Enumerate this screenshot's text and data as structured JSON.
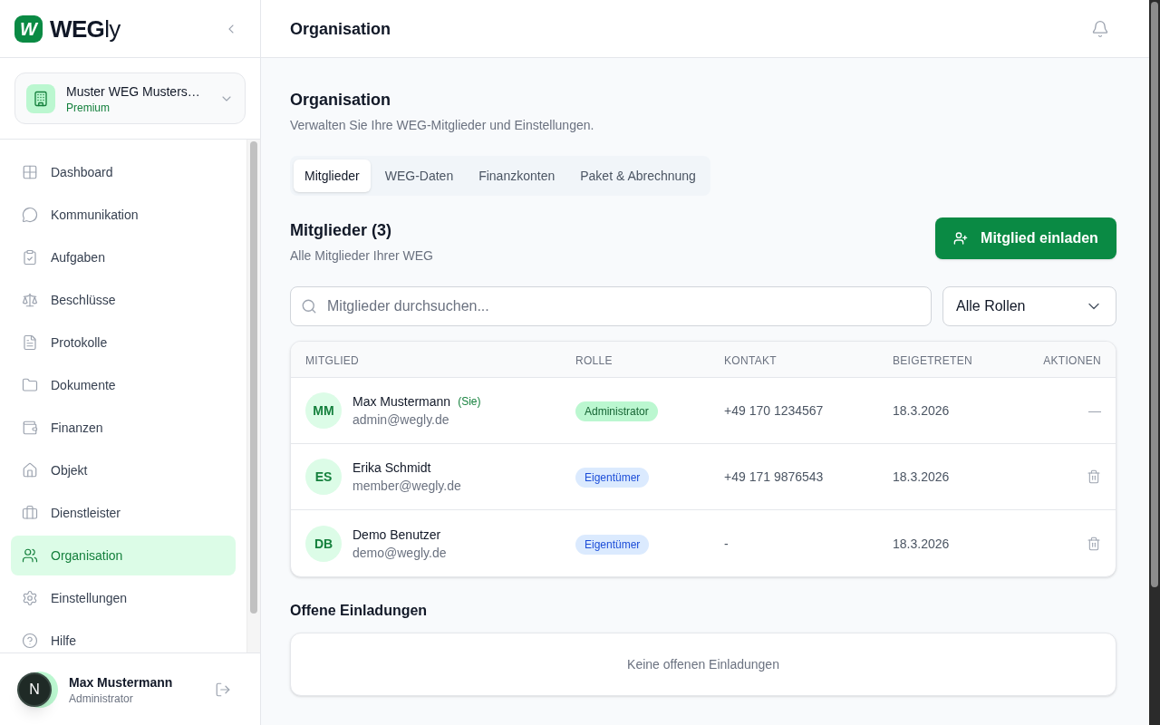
{
  "sidebar": {
    "brand": {
      "mark": "W",
      "name": "**WEG**ly"
    },
    "organization": {
      "name": "Muster WEG Musters…",
      "plan": "Premium"
    },
    "nav_items": [
      {
        "label": "Dashboard",
        "selected": false
      },
      {
        "label": "Kommunikation",
        "selected": false
      },
      {
        "label": "Aufgaben",
        "selected": false
      },
      {
        "label": "Beschlüsse",
        "selected": false
      },
      {
        "label": "Protokolle",
        "selected": false
      },
      {
        "label": "Dokumente",
        "selected": false
      },
      {
        "label": "Finanzen",
        "selected": false
      },
      {
        "label": "Objekt",
        "selected": false
      },
      {
        "label": "Dienstleister",
        "selected": false
      },
      {
        "label": "Organisation",
        "selected": true
      },
      {
        "label": "Einstellungen",
        "selected": false
      },
      {
        "label": "Hilfe",
        "selected": false
      }
    ],
    "user": {
      "name": "Max Mustermann",
      "role": "Administrator"
    },
    "dev_badge": "N"
  },
  "header": {
    "title": "Organisation"
  },
  "page": {
    "title": "Organisation",
    "subtitle": "Verwalten Sie Ihre WEG-Mitglieder und Einstellungen."
  },
  "tabs": [
    {
      "label": "Mitglieder",
      "selected": true
    },
    {
      "label": "WEG-Daten",
      "selected": false
    },
    {
      "label": "Finanzkonten",
      "selected": false
    },
    {
      "label": "Paket & Abrechnung",
      "selected": false
    }
  ],
  "members": {
    "title": "Mitglieder (3)",
    "subtitle": "Alle Mitglieder Ihrer WEG",
    "invite_button": "Mitglied einladen",
    "search": {
      "placeholder": "Mitglieder durchsuchen..."
    },
    "role_filter": {
      "value": "Alle Rollen"
    },
    "table": {
      "columns": [
        "MITGLIED",
        "ROLLE",
        "KONTAKT",
        "BEIGETRETEN",
        "AKTIONEN"
      ],
      "rows": [
        {
          "initials": "MM",
          "name": "Max Mustermann",
          "self_tag": "(Sie)",
          "email": "admin@wegly.de",
          "role": {
            "label": "Administrator",
            "kind": "admin"
          },
          "contact": "+49 170 1234567",
          "joined": "18.3.2026",
          "action": {
            "kind": "none",
            "text": "—"
          }
        },
        {
          "initials": "ES",
          "name": "Erika Schmidt",
          "email": "member@wegly.de",
          "role": {
            "label": "Eigentümer",
            "kind": "owner"
          },
          "contact": "+49 171 9876543",
          "joined": "18.3.2026",
          "action": {
            "kind": "delete"
          }
        },
        {
          "initials": "DB",
          "name": "Demo Benutzer",
          "email": "demo@wegly.de",
          "role": {
            "label": "Eigentümer",
            "kind": "owner"
          },
          "contact": "-",
          "joined": "18.3.2026",
          "action": {
            "kind": "delete"
          }
        }
      ]
    }
  },
  "invitations": {
    "title": "Offene Einladungen",
    "empty_text": "Keine offenen Einladungen"
  }
}
